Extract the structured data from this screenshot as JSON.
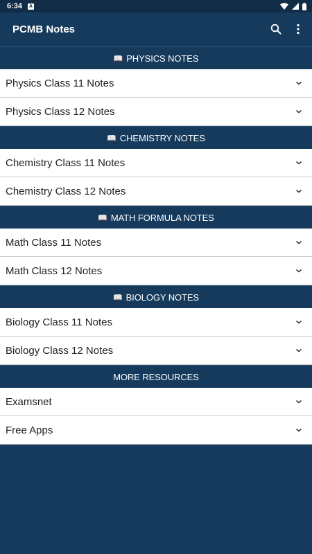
{
  "status_bar": {
    "time": "6:34",
    "notification_badge": "A"
  },
  "app_bar": {
    "title": "PCMB Notes",
    "search_icon": "search-icon",
    "menu_icon": "more-vert-icon"
  },
  "sections": [
    {
      "header": "PHYSICS NOTES",
      "icon": "📖",
      "items": [
        "Physics Class 11 Notes",
        "Physics Class 12 Notes"
      ]
    },
    {
      "header": "CHEMISTRY NOTES",
      "icon": "📖",
      "items": [
        "Chemistry Class 11 Notes",
        "Chemistry Class 12 Notes"
      ]
    },
    {
      "header": "MATH FORMULA NOTES",
      "icon": "📖",
      "items": [
        "Math Class 11 Notes",
        "Math Class 12 Notes"
      ]
    },
    {
      "header": "BIOLOGY NOTES",
      "icon": "📖",
      "items": [
        "Biology Class 11 Notes",
        "Biology Class 12 Notes"
      ]
    },
    {
      "header": "MORE RESOURCES",
      "icon": "",
      "items": [
        "Examsnet",
        "Free Apps"
      ]
    }
  ],
  "colors": {
    "primary": "#163a5c",
    "status_bar": "#102c47",
    "item_bg": "#ffffff",
    "text": "#222222"
  }
}
